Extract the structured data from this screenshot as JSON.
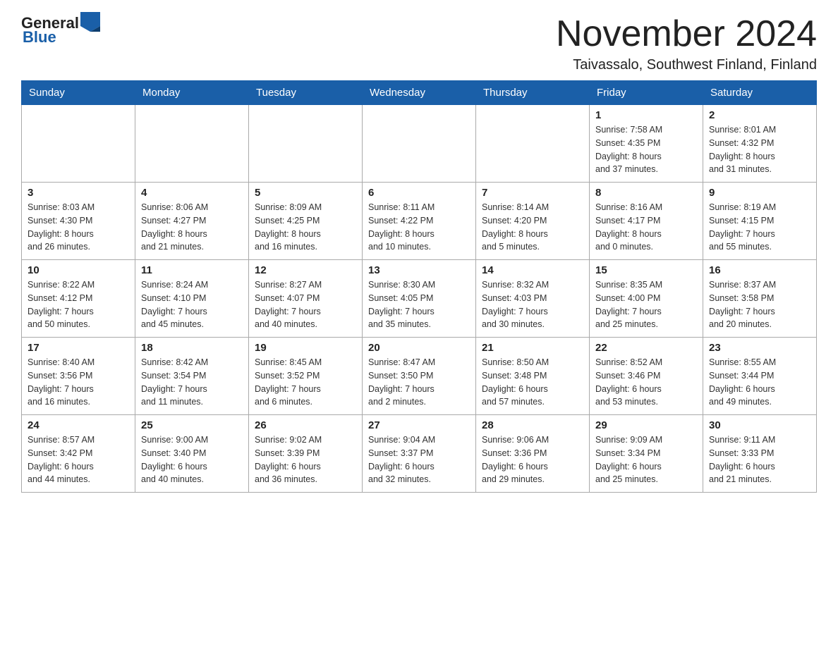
{
  "header": {
    "logo_general": "General",
    "logo_blue": "Blue",
    "month_title": "November 2024",
    "subtitle": "Taivassalo, Southwest Finland, Finland"
  },
  "weekdays": [
    "Sunday",
    "Monday",
    "Tuesday",
    "Wednesday",
    "Thursday",
    "Friday",
    "Saturday"
  ],
  "weeks": [
    [
      {
        "day": "",
        "info": ""
      },
      {
        "day": "",
        "info": ""
      },
      {
        "day": "",
        "info": ""
      },
      {
        "day": "",
        "info": ""
      },
      {
        "day": "",
        "info": ""
      },
      {
        "day": "1",
        "info": "Sunrise: 7:58 AM\nSunset: 4:35 PM\nDaylight: 8 hours\nand 37 minutes."
      },
      {
        "day": "2",
        "info": "Sunrise: 8:01 AM\nSunset: 4:32 PM\nDaylight: 8 hours\nand 31 minutes."
      }
    ],
    [
      {
        "day": "3",
        "info": "Sunrise: 8:03 AM\nSunset: 4:30 PM\nDaylight: 8 hours\nand 26 minutes."
      },
      {
        "day": "4",
        "info": "Sunrise: 8:06 AM\nSunset: 4:27 PM\nDaylight: 8 hours\nand 21 minutes."
      },
      {
        "day": "5",
        "info": "Sunrise: 8:09 AM\nSunset: 4:25 PM\nDaylight: 8 hours\nand 16 minutes."
      },
      {
        "day": "6",
        "info": "Sunrise: 8:11 AM\nSunset: 4:22 PM\nDaylight: 8 hours\nand 10 minutes."
      },
      {
        "day": "7",
        "info": "Sunrise: 8:14 AM\nSunset: 4:20 PM\nDaylight: 8 hours\nand 5 minutes."
      },
      {
        "day": "8",
        "info": "Sunrise: 8:16 AM\nSunset: 4:17 PM\nDaylight: 8 hours\nand 0 minutes."
      },
      {
        "day": "9",
        "info": "Sunrise: 8:19 AM\nSunset: 4:15 PM\nDaylight: 7 hours\nand 55 minutes."
      }
    ],
    [
      {
        "day": "10",
        "info": "Sunrise: 8:22 AM\nSunset: 4:12 PM\nDaylight: 7 hours\nand 50 minutes."
      },
      {
        "day": "11",
        "info": "Sunrise: 8:24 AM\nSunset: 4:10 PM\nDaylight: 7 hours\nand 45 minutes."
      },
      {
        "day": "12",
        "info": "Sunrise: 8:27 AM\nSunset: 4:07 PM\nDaylight: 7 hours\nand 40 minutes."
      },
      {
        "day": "13",
        "info": "Sunrise: 8:30 AM\nSunset: 4:05 PM\nDaylight: 7 hours\nand 35 minutes."
      },
      {
        "day": "14",
        "info": "Sunrise: 8:32 AM\nSunset: 4:03 PM\nDaylight: 7 hours\nand 30 minutes."
      },
      {
        "day": "15",
        "info": "Sunrise: 8:35 AM\nSunset: 4:00 PM\nDaylight: 7 hours\nand 25 minutes."
      },
      {
        "day": "16",
        "info": "Sunrise: 8:37 AM\nSunset: 3:58 PM\nDaylight: 7 hours\nand 20 minutes."
      }
    ],
    [
      {
        "day": "17",
        "info": "Sunrise: 8:40 AM\nSunset: 3:56 PM\nDaylight: 7 hours\nand 16 minutes."
      },
      {
        "day": "18",
        "info": "Sunrise: 8:42 AM\nSunset: 3:54 PM\nDaylight: 7 hours\nand 11 minutes."
      },
      {
        "day": "19",
        "info": "Sunrise: 8:45 AM\nSunset: 3:52 PM\nDaylight: 7 hours\nand 6 minutes."
      },
      {
        "day": "20",
        "info": "Sunrise: 8:47 AM\nSunset: 3:50 PM\nDaylight: 7 hours\nand 2 minutes."
      },
      {
        "day": "21",
        "info": "Sunrise: 8:50 AM\nSunset: 3:48 PM\nDaylight: 6 hours\nand 57 minutes."
      },
      {
        "day": "22",
        "info": "Sunrise: 8:52 AM\nSunset: 3:46 PM\nDaylight: 6 hours\nand 53 minutes."
      },
      {
        "day": "23",
        "info": "Sunrise: 8:55 AM\nSunset: 3:44 PM\nDaylight: 6 hours\nand 49 minutes."
      }
    ],
    [
      {
        "day": "24",
        "info": "Sunrise: 8:57 AM\nSunset: 3:42 PM\nDaylight: 6 hours\nand 44 minutes."
      },
      {
        "day": "25",
        "info": "Sunrise: 9:00 AM\nSunset: 3:40 PM\nDaylight: 6 hours\nand 40 minutes."
      },
      {
        "day": "26",
        "info": "Sunrise: 9:02 AM\nSunset: 3:39 PM\nDaylight: 6 hours\nand 36 minutes."
      },
      {
        "day": "27",
        "info": "Sunrise: 9:04 AM\nSunset: 3:37 PM\nDaylight: 6 hours\nand 32 minutes."
      },
      {
        "day": "28",
        "info": "Sunrise: 9:06 AM\nSunset: 3:36 PM\nDaylight: 6 hours\nand 29 minutes."
      },
      {
        "day": "29",
        "info": "Sunrise: 9:09 AM\nSunset: 3:34 PM\nDaylight: 6 hours\nand 25 minutes."
      },
      {
        "day": "30",
        "info": "Sunrise: 9:11 AM\nSunset: 3:33 PM\nDaylight: 6 hours\nand 21 minutes."
      }
    ]
  ]
}
